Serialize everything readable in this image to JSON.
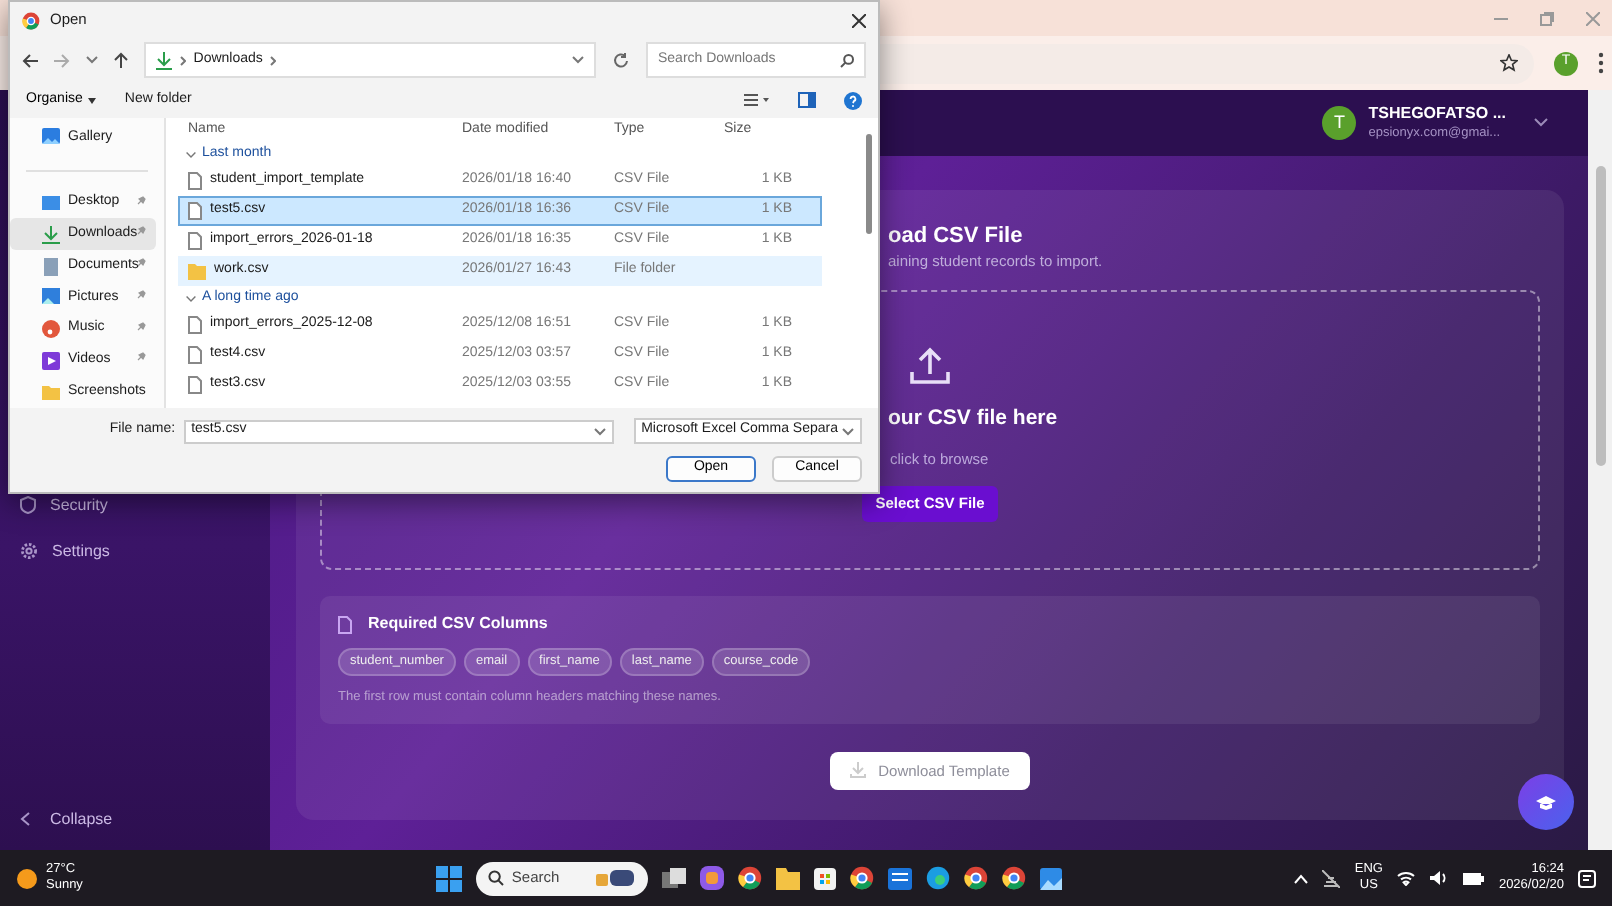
{
  "browser": {
    "profile_initial": "T"
  },
  "app": {
    "sidebar": {
      "items": [
        {
          "label": "Security",
          "kind": "shield"
        },
        {
          "label": "Settings",
          "kind": "gear"
        }
      ],
      "collapse": "Collapse"
    },
    "user": {
      "initial": "T",
      "name": "TSHEGOFATSO ...",
      "email": "epsionyx.com@gmai..."
    },
    "upload": {
      "title": "oad CSV File",
      "subtitle": "aining student records to import.",
      "drop_title": "our CSV file here",
      "drop_hint": "click to browse",
      "button": "Select CSV File"
    },
    "required": {
      "title": "Required CSV Columns",
      "columns": [
        "student_number",
        "email",
        "first_name",
        "last_name",
        "course_code"
      ],
      "note": "The first row must contain column headers matching these names."
    },
    "download_button": "Download Template"
  },
  "dialog": {
    "title": "Open",
    "path": [
      "Downloads"
    ],
    "search_placeholder": "Search Downloads",
    "organise": "Organise",
    "new_folder": "New folder",
    "nav": [
      {
        "label": "Gallery",
        "kind": "gallery",
        "pinned": false,
        "selected": false
      },
      {
        "label": "Desktop",
        "kind": "desktop",
        "pinned": true,
        "selected": false
      },
      {
        "label": "Downloads",
        "kind": "downloads",
        "pinned": true,
        "selected": true
      },
      {
        "label": "Documents",
        "kind": "documents",
        "pinned": true,
        "selected": false
      },
      {
        "label": "Pictures",
        "kind": "pictures",
        "pinned": true,
        "selected": false
      },
      {
        "label": "Music",
        "kind": "music",
        "pinned": true,
        "selected": false
      },
      {
        "label": "Videos",
        "kind": "videos",
        "pinned": true,
        "selected": false
      },
      {
        "label": "Screenshots",
        "kind": "folder",
        "pinned": false,
        "selected": false
      }
    ],
    "columns": [
      "Name",
      "Date modified",
      "Type",
      "Size"
    ],
    "groups": [
      {
        "label": "Last month",
        "expanded": true,
        "files": [
          {
            "name": "student_import_template",
            "date": "2026/01/18 16:40",
            "type": "CSV File",
            "size": "1 KB",
            "kind": "file",
            "selected": false,
            "hover": false
          },
          {
            "name": "test5.csv",
            "date": "2026/01/18 16:36",
            "type": "CSV File",
            "size": "1 KB",
            "kind": "file",
            "selected": true,
            "hover": false
          },
          {
            "name": "import_errors_2026-01-18",
            "date": "2026/01/18 16:35",
            "type": "CSV File",
            "size": "1 KB",
            "kind": "file",
            "selected": false,
            "hover": false
          },
          {
            "name": "work.csv",
            "date": "2026/01/27 16:43",
            "type": "File folder",
            "kind": "folder",
            "selected": false,
            "hover": true
          }
        ]
      },
      {
        "label": "A long time ago",
        "expanded": true,
        "files": [
          {
            "name": "import_errors_2025-12-08",
            "date": "2025/12/08 16:51",
            "type": "CSV File",
            "size": "1 KB",
            "kind": "file",
            "selected": false,
            "hover": false
          },
          {
            "name": "test4.csv",
            "date": "2025/12/03 03:57",
            "type": "CSV File",
            "size": "1 KB",
            "kind": "file",
            "selected": false,
            "hover": false
          },
          {
            "name": "test3.csv",
            "date": "2025/12/03 03:55",
            "type": "CSV File",
            "size": "1 KB",
            "kind": "file",
            "selected": false,
            "hover": false
          }
        ]
      }
    ],
    "file_name_label": "File name:",
    "file_name": "test5.csv",
    "file_type": "Microsoft Excel Comma Separa",
    "buttons": [
      "Open",
      "Cancel"
    ]
  },
  "taskbar": {
    "temperature": "27°C",
    "condition": "Sunny",
    "search_placeholder": "Search",
    "apps": [
      {
        "kind": "windows"
      },
      {
        "kind": "search"
      },
      {
        "kind": "taskview"
      },
      {
        "kind": "copilot"
      },
      {
        "kind": "browser"
      },
      {
        "kind": "folder"
      },
      {
        "kind": "store"
      },
      {
        "kind": "browser"
      },
      {
        "kind": "mail"
      },
      {
        "kind": "edge"
      },
      {
        "kind": "browser"
      },
      {
        "kind": "browser"
      },
      {
        "kind": "photos"
      }
    ],
    "language": "ENG",
    "region": "US",
    "time": "16:24",
    "date": "2026/02/20"
  }
}
